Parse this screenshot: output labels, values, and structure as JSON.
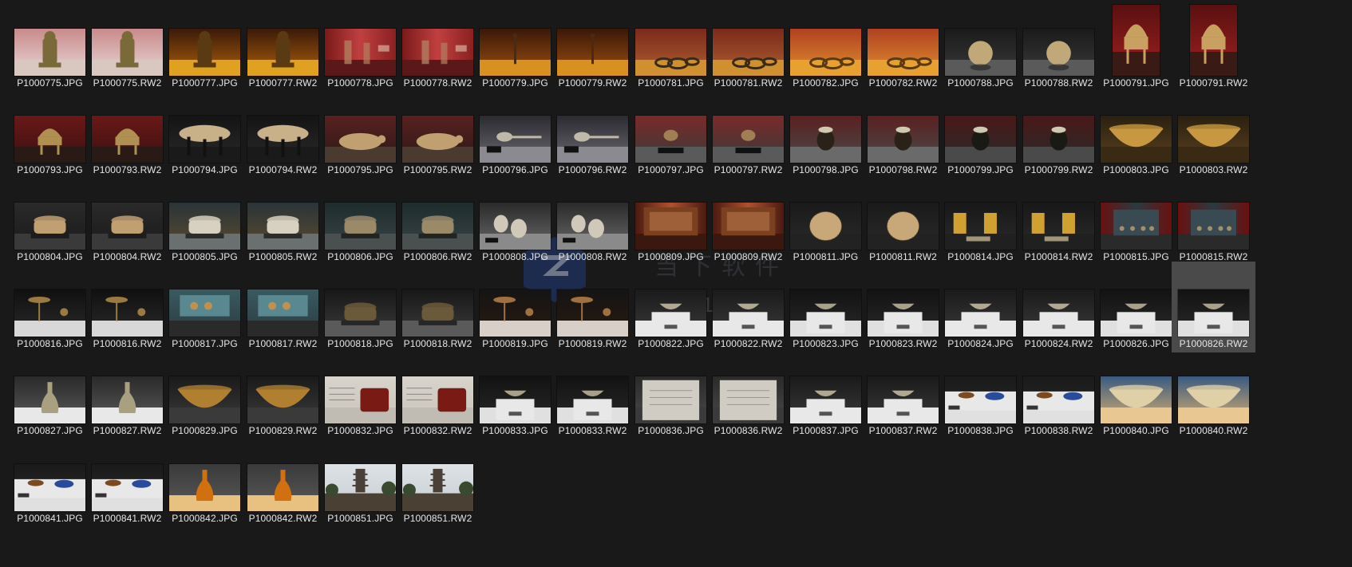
{
  "watermark": {
    "text": "AiLab1.com",
    "cn": "当下软件园"
  },
  "files": [
    {
      "name": "P1000775.JPG",
      "scene": "redlight-statue"
    },
    {
      "name": "P1000775.RW2",
      "scene": "redlight-statue"
    },
    {
      "name": "P1000777.JPG",
      "scene": "amber-statue"
    },
    {
      "name": "P1000777.RW2",
      "scene": "amber-statue"
    },
    {
      "name": "P1000778.JPG",
      "scene": "red-wall"
    },
    {
      "name": "P1000778.RW2",
      "scene": "red-wall"
    },
    {
      "name": "P1000779.JPG",
      "scene": "amber-thin"
    },
    {
      "name": "P1000779.RW2",
      "scene": "amber-thin"
    },
    {
      "name": "P1000781.JPG",
      "scene": "amber-rings"
    },
    {
      "name": "P1000781.RW2",
      "scene": "amber-rings"
    },
    {
      "name": "P1000782.JPG",
      "scene": "amber-case"
    },
    {
      "name": "P1000782.RW2",
      "scene": "amber-case"
    },
    {
      "name": "P1000788.JPG",
      "scene": "dark-sphere"
    },
    {
      "name": "P1000788.RW2",
      "scene": "dark-sphere"
    },
    {
      "name": "P1000791.JPG",
      "scene": "red-censer",
      "portrait": true
    },
    {
      "name": "P1000791.RW2",
      "scene": "red-censer",
      "portrait": true
    },
    {
      "name": "P1000793.JPG",
      "scene": "red-tripod"
    },
    {
      "name": "P1000793.RW2",
      "scene": "red-tripod"
    },
    {
      "name": "P1000794.JPG",
      "scene": "dark-plate"
    },
    {
      "name": "P1000794.RW2",
      "scene": "dark-plate"
    },
    {
      "name": "P1000795.JPG",
      "scene": "red-turtle"
    },
    {
      "name": "P1000795.RW2",
      "scene": "red-turtle"
    },
    {
      "name": "P1000796.JPG",
      "scene": "grey-spoon"
    },
    {
      "name": "P1000796.RW2",
      "scene": "grey-spoon"
    },
    {
      "name": "P1000797.JPG",
      "scene": "grey-small"
    },
    {
      "name": "P1000797.RW2",
      "scene": "grey-small"
    },
    {
      "name": "P1000798.JPG",
      "scene": "grey-jar"
    },
    {
      "name": "P1000798.RW2",
      "scene": "grey-jar"
    },
    {
      "name": "P1000799.JPG",
      "scene": "dark-lidjar"
    },
    {
      "name": "P1000799.RW2",
      "scene": "dark-lidjar"
    },
    {
      "name": "P1000803.JPG",
      "scene": "gold-bowl"
    },
    {
      "name": "P1000803.RW2",
      "scene": "gold-bowl"
    },
    {
      "name": "P1000804.JPG",
      "scene": "dark-box"
    },
    {
      "name": "P1000804.RW2",
      "scene": "dark-box"
    },
    {
      "name": "P1000805.JPG",
      "scene": "teal-box"
    },
    {
      "name": "P1000805.RW2",
      "scene": "teal-box"
    },
    {
      "name": "P1000806.JPG",
      "scene": "teal-square"
    },
    {
      "name": "P1000806.RW2",
      "scene": "teal-square"
    },
    {
      "name": "P1000808.JPG",
      "scene": "grey-stack"
    },
    {
      "name": "P1000808.RW2",
      "scene": "grey-stack"
    },
    {
      "name": "P1000809.JPG",
      "scene": "red-painting"
    },
    {
      "name": "P1000809.RW2",
      "scene": "red-painting"
    },
    {
      "name": "P1000811.JPG",
      "scene": "dark-basket"
    },
    {
      "name": "P1000811.RW2",
      "scene": "dark-basket"
    },
    {
      "name": "P1000814.JPG",
      "scene": "dark-cards"
    },
    {
      "name": "P1000814.RW2",
      "scene": "dark-cards"
    },
    {
      "name": "P1000815.JPG",
      "scene": "teal-panel"
    },
    {
      "name": "P1000815.RW2",
      "scene": "teal-panel"
    },
    {
      "name": "P1000816.JPG",
      "scene": "dark-lamp"
    },
    {
      "name": "P1000816.RW2",
      "scene": "dark-lamp"
    },
    {
      "name": "P1000817.JPG",
      "scene": "teal-coins"
    },
    {
      "name": "P1000817.RW2",
      "scene": "teal-coins"
    },
    {
      "name": "P1000818.JPG",
      "scene": "dark-chest"
    },
    {
      "name": "P1000818.RW2",
      "scene": "dark-chest"
    },
    {
      "name": "P1000819.JPG",
      "scene": "dark-stand"
    },
    {
      "name": "P1000819.RW2",
      "scene": "dark-stand"
    },
    {
      "name": "P1000822.JPG",
      "scene": "white-plinth"
    },
    {
      "name": "P1000822.RW2",
      "scene": "white-plinth"
    },
    {
      "name": "P1000823.JPG",
      "scene": "dark-plinth"
    },
    {
      "name": "P1000823.RW2",
      "scene": "dark-plinth"
    },
    {
      "name": "P1000824.JPG",
      "scene": "white-plinth"
    },
    {
      "name": "P1000824.RW2",
      "scene": "white-plinth"
    },
    {
      "name": "P1000826.JPG",
      "scene": "dark-plinth"
    },
    {
      "name": "P1000826.RW2",
      "scene": "dark-plinth",
      "selected": true
    },
    {
      "name": "P1000827.JPG",
      "scene": "white-vase"
    },
    {
      "name": "P1000827.RW2",
      "scene": "white-vase"
    },
    {
      "name": "P1000829.JPG",
      "scene": "dark-bowl"
    },
    {
      "name": "P1000829.RW2",
      "scene": "dark-bowl"
    },
    {
      "name": "P1000832.JPG",
      "scene": "wall-text"
    },
    {
      "name": "P1000832.RW2",
      "scene": "wall-text"
    },
    {
      "name": "P1000833.JPG",
      "scene": "dark-plinth"
    },
    {
      "name": "P1000833.RW2",
      "scene": "dark-plinth"
    },
    {
      "name": "P1000836.JPG",
      "scene": "text-panel"
    },
    {
      "name": "P1000836.RW2",
      "scene": "text-panel"
    },
    {
      "name": "P1000837.JPG",
      "scene": "white-plinth"
    },
    {
      "name": "P1000837.RW2",
      "scene": "white-plinth"
    },
    {
      "name": "P1000838.JPG",
      "scene": "white-dishes"
    },
    {
      "name": "P1000838.RW2",
      "scene": "white-dishes"
    },
    {
      "name": "P1000840.JPG",
      "scene": "blue-glass"
    },
    {
      "name": "P1000840.RW2",
      "scene": "blue-glass"
    },
    {
      "name": "P1000841.JPG",
      "scene": "white-dishes"
    },
    {
      "name": "P1000841.RW2",
      "scene": "white-dishes"
    },
    {
      "name": "P1000842.JPG",
      "scene": "amber-vessel"
    },
    {
      "name": "P1000842.RW2",
      "scene": "amber-vessel"
    },
    {
      "name": "P1000851.JPG",
      "scene": "pagoda"
    },
    {
      "name": "P1000851.RW2",
      "scene": "pagoda"
    }
  ]
}
